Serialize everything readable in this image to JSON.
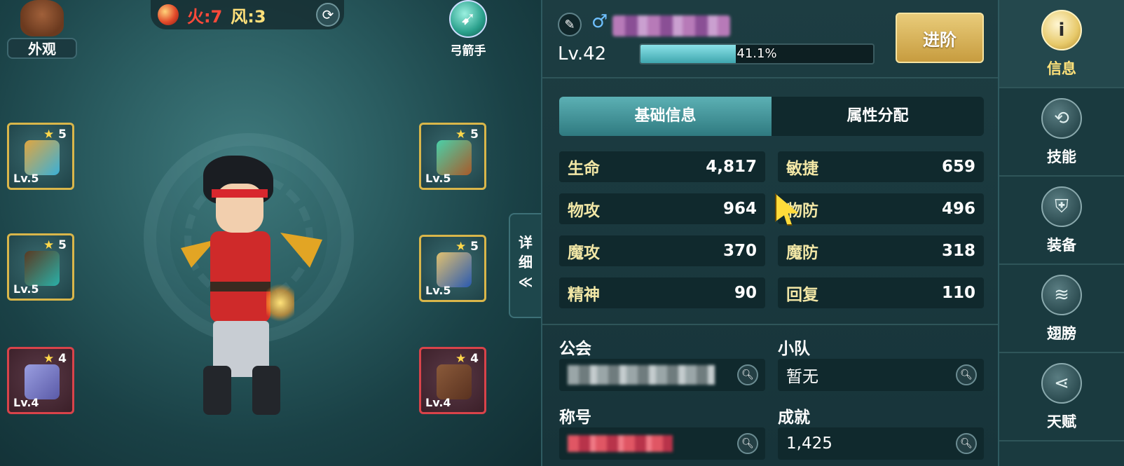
{
  "scene": {
    "appearance_label": "外观",
    "elements": {
      "fire": "火:7",
      "wind": "风:3"
    },
    "class_label": "弓箭手",
    "equipment": [
      {
        "stars": "5",
        "level": "Lv.5",
        "rarity": "gold",
        "icon": "arrow-quiver-icon"
      },
      {
        "stars": "5",
        "level": "Lv.5",
        "rarity": "gold",
        "icon": "bow-icon"
      },
      {
        "stars": "4",
        "level": "Lv.4",
        "rarity": "red",
        "icon": "helmet-icon"
      },
      {
        "stars": "5",
        "level": "Lv.5",
        "rarity": "gold",
        "icon": "ring-icon"
      },
      {
        "stars": "5",
        "level": "Lv.5",
        "rarity": "gold",
        "icon": "armor-icon"
      },
      {
        "stars": "4",
        "level": "Lv.4",
        "rarity": "red",
        "icon": "boots-icon"
      }
    ],
    "detail_tab": [
      "详",
      "细",
      "≪"
    ]
  },
  "panel": {
    "level": "Lv.42",
    "exp_percent": 41.1,
    "exp_text": "41.1%",
    "advance_button": "进阶",
    "tabs": [
      {
        "label": "基础信息",
        "active": true
      },
      {
        "label": "属性分配",
        "active": false
      }
    ],
    "stats": [
      [
        {
          "label": "生命",
          "value": "4,817",
          "color": "#f2e7a6"
        },
        {
          "label": "敏捷",
          "value": "659",
          "color": "#f2e7a6"
        }
      ],
      [
        {
          "label": "物攻",
          "value": "964",
          "color": "#f2e7a6"
        },
        {
          "label": "物防",
          "value": "496",
          "color": "#f2e7a6"
        }
      ],
      [
        {
          "label": "魔攻",
          "value": "370",
          "color": "#f2e7a6"
        },
        {
          "label": "魔防",
          "value": "318",
          "color": "#f2e7a6"
        }
      ],
      [
        {
          "label": "精神",
          "value": "90",
          "color": "#f2e7a6"
        },
        {
          "label": "回复",
          "value": "110",
          "color": "#f2e7a6"
        }
      ]
    ],
    "guild_label": "公会",
    "team_label": "小队",
    "team_value": "暂无",
    "title_label": "称号",
    "achievement_label": "成就",
    "achievement_value": "1,425"
  },
  "sidebar": [
    {
      "label": "信息",
      "icon": "info-icon",
      "glyph": "i",
      "active": true
    },
    {
      "label": "技能",
      "icon": "skill-icon",
      "glyph": "⟲",
      "active": false
    },
    {
      "label": "装备",
      "icon": "equipment-icon",
      "glyph": "⛨",
      "active": false
    },
    {
      "label": "翅膀",
      "icon": "wings-icon",
      "glyph": "≋",
      "active": false
    },
    {
      "label": "天赋",
      "icon": "talent-icon",
      "glyph": "⋖",
      "active": false
    }
  ],
  "colors": {
    "accent": "#5cb0b4",
    "gold": "#d9b64a",
    "red_rarity": "#d9434a",
    "stat_label": "#f2e7a6"
  }
}
